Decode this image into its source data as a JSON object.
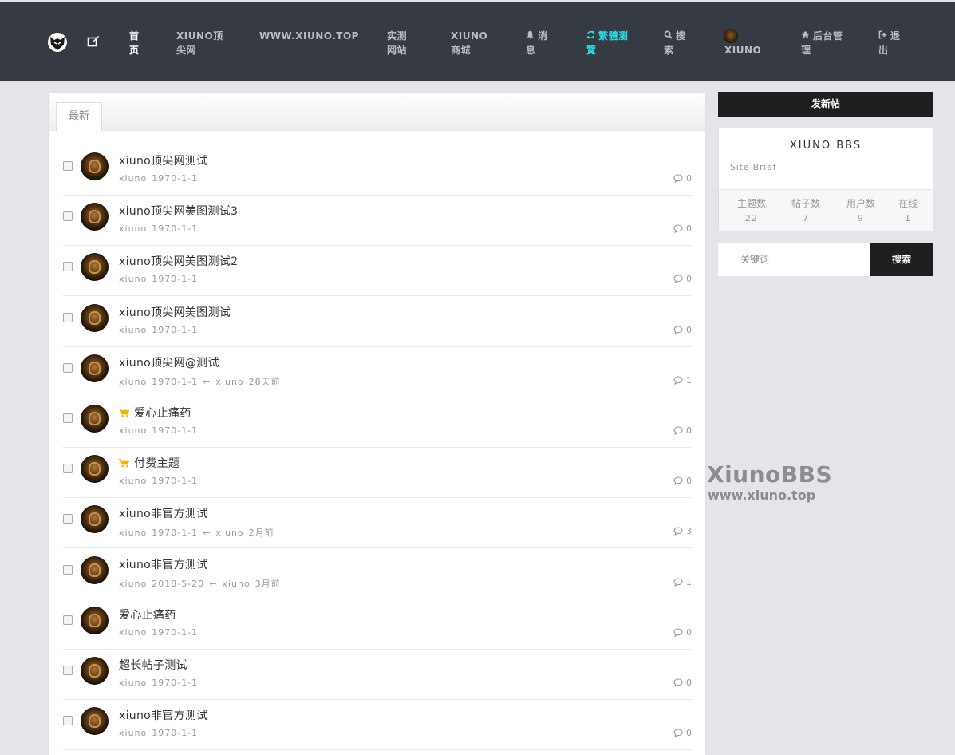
{
  "nav": {
    "items": [
      {
        "label": "首页",
        "lines": [
          "首",
          "页"
        ]
      },
      {
        "label": "XIUNO顶尖网",
        "lines": [
          "XIUNO顶",
          "尖网"
        ]
      },
      {
        "label": "WWW.XIUNO.TOP",
        "lines": [
          "WWW.XIUNO.TOP"
        ]
      },
      {
        "label": "实测网站",
        "lines": [
          "实测",
          "网站"
        ]
      },
      {
        "label": "XIUNO商城",
        "lines": [
          "XIUNO",
          "商城"
        ]
      },
      {
        "label": "消息",
        "lines": [
          "消",
          "息"
        ],
        "icon": "bell-icon"
      },
      {
        "label": "繁體瀏覽",
        "lines": [
          "繁體瀏",
          "覽"
        ],
        "icon": "refresh-icon"
      },
      {
        "label": "搜索",
        "lines": [
          "搜",
          "索"
        ],
        "icon": "search-icon"
      },
      {
        "label": "XIUNO",
        "lines": [
          "XIUNO"
        ]
      },
      {
        "label": "后台管理",
        "lines": [
          "后台管",
          "理"
        ],
        "icon": "home-icon"
      },
      {
        "label": "退出",
        "lines": [
          "退",
          "出"
        ],
        "icon": "sign-out-icon"
      }
    ]
  },
  "tab_label": "最新",
  "threads": [
    {
      "title": "xiuno顶尖网测试",
      "meta": [
        "xiuno",
        "1970-1-1"
      ],
      "count": "0"
    },
    {
      "title": "xiuno顶尖网美图测试3",
      "meta": [
        "xiuno",
        "1970-1-1"
      ],
      "count": "0"
    },
    {
      "title": "xiuno顶尖网美图测试2",
      "meta": [
        "xiuno",
        "1970-1-1"
      ],
      "count": "0"
    },
    {
      "title": "xiuno顶尖网美图测试",
      "meta": [
        "xiuno",
        "1970-1-1"
      ],
      "count": "0"
    },
    {
      "title": "xiuno顶尖网@测试",
      "meta": [
        "xiuno",
        "1970-1-1",
        "←",
        "xiuno",
        "28天前"
      ],
      "count": "1"
    },
    {
      "title": "爱心止痛药",
      "meta": [
        "xiuno",
        "1970-1-1"
      ],
      "count": "0",
      "cart": true
    },
    {
      "title": "付费主题",
      "meta": [
        "xiuno",
        "1970-1-1"
      ],
      "count": "0",
      "cart": true
    },
    {
      "title": "xiuno非官方测试",
      "meta": [
        "xiuno",
        "1970-1-1",
        "←",
        "xiuno",
        "2月前"
      ],
      "count": "3"
    },
    {
      "title": "xiuno非官方测试",
      "meta": [
        "xiuno",
        "2018-5-20",
        "←",
        "xiuno",
        "3月前"
      ],
      "count": "1"
    },
    {
      "title": "爱心止痛药",
      "meta": [
        "xiuno",
        "1970-1-1"
      ],
      "count": "0"
    },
    {
      "title": "超长帖子测试",
      "meta": [
        "xiuno",
        "1970-1-1"
      ],
      "count": "0"
    },
    {
      "title": "xiuno非官方测试",
      "meta": [
        "xiuno",
        "1970-1-1"
      ],
      "count": "0"
    }
  ],
  "sidebar": {
    "new_post": "发新帖",
    "site_name": "XIUNO BBS",
    "site_brief": "Site Brief",
    "stats": [
      {
        "label": "主题数",
        "value": "22"
      },
      {
        "label": "帖子数",
        "value": "7"
      },
      {
        "label": "用户数",
        "value": "9"
      },
      {
        "label": "在线",
        "value": "1"
      }
    ],
    "search_placeholder": "关键词",
    "search_button": "搜索"
  },
  "watermark": {
    "line1": "XiunoBBS",
    "line2": "www.xiuno.top"
  },
  "colors": {
    "navbar": "#363b43",
    "accent_cyan": "#2fd8e6",
    "cart_yellow": "#f5b400",
    "dark_button": "#1d1e20"
  }
}
